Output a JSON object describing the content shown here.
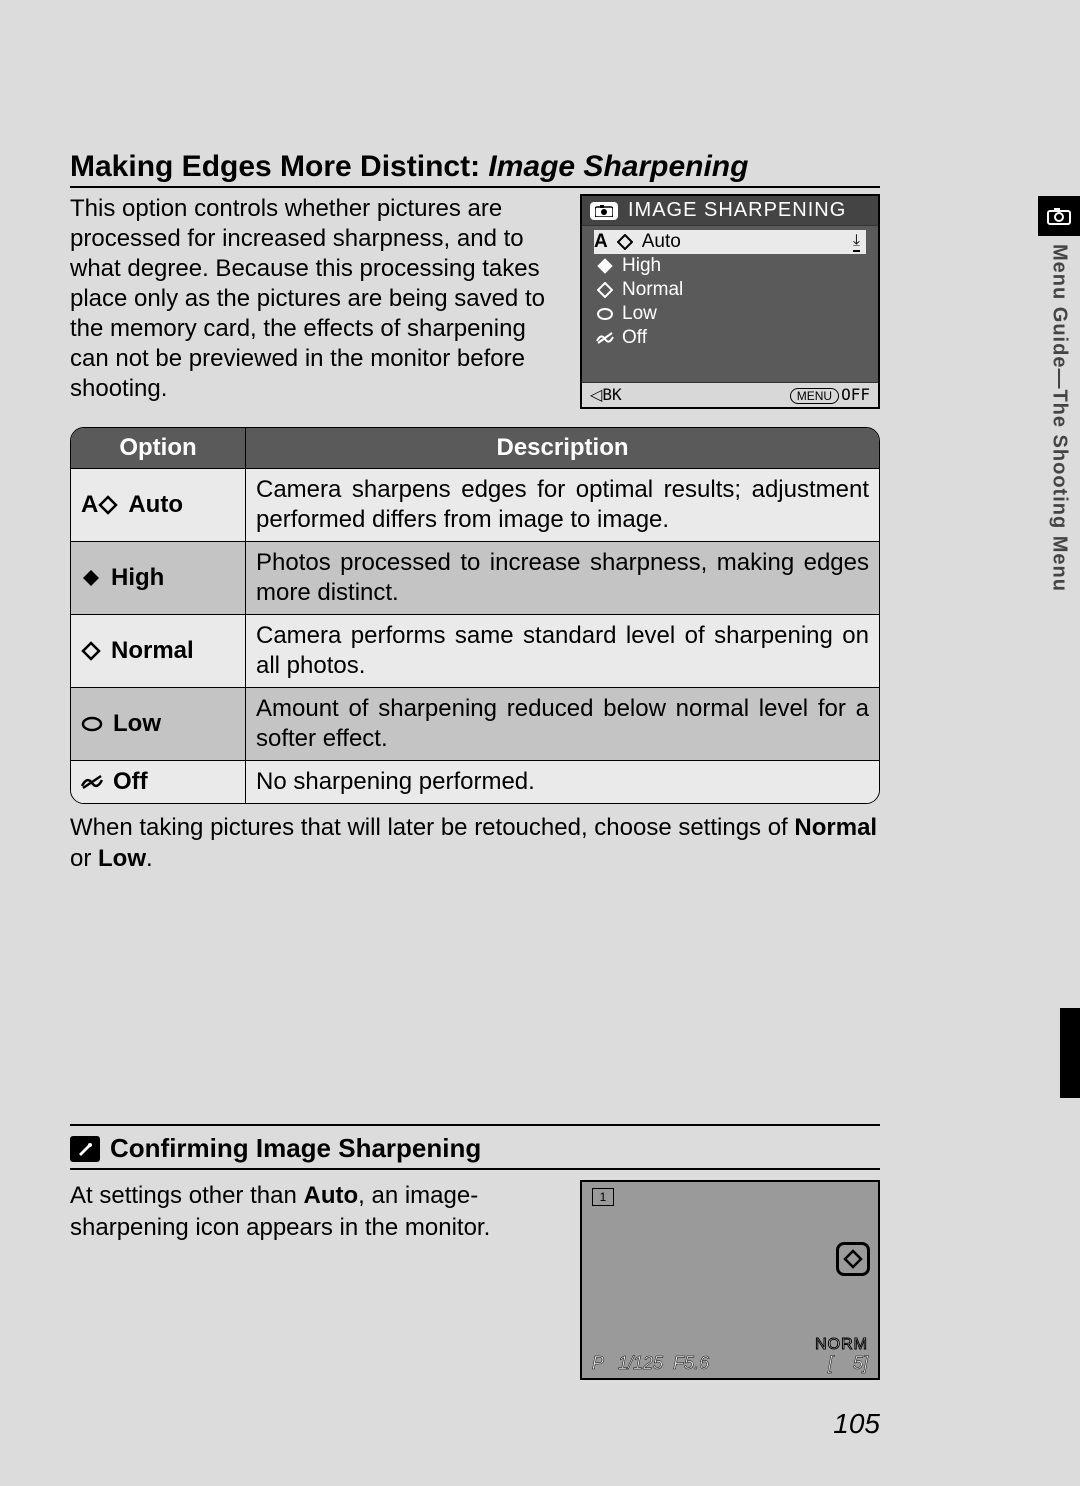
{
  "heading": {
    "prefix": "Making Edges More Distinct: ",
    "emph": "Image Sharpening"
  },
  "intro_text": "This option controls whether pictures are processed for increased sharpness, and to what degree. Because this processing takes place only as the pictures are being saved to the memory card, the effects of sharpening can not be previewed in the monitor before shooting.",
  "camera_screen": {
    "title": "IMAGE SHARPENING",
    "items": [
      "Auto",
      "High",
      "Normal",
      "Low",
      "Off"
    ],
    "selected_prefix": "A",
    "footer_back": "BK",
    "footer_menu": "MENU",
    "footer_off": "OFF"
  },
  "table": {
    "head_option": "Option",
    "head_desc": "Description",
    "rows": [
      {
        "prefix": "A",
        "name": "Auto",
        "desc": "Camera sharpens edges for optimal results; adjustment performed differs from image to image."
      },
      {
        "prefix": "",
        "name": "High",
        "desc": "Photos processed to increase sharpness, making edges more distinct."
      },
      {
        "prefix": "",
        "name": "Normal",
        "desc": "Camera performs same standard level of sharpening on all photos."
      },
      {
        "prefix": "",
        "name": "Low",
        "desc": "Amount of sharpening reduced below normal level for a softer effect."
      },
      {
        "prefix": "",
        "name": "Off",
        "desc": "No sharpening performed."
      }
    ]
  },
  "note": {
    "pre": "When taking pictures that will later be retouched, choose settings of ",
    "b1": "Normal",
    "mid": " or ",
    "b2": "Low",
    "post": "."
  },
  "subsection": {
    "heading": "Confirming Image Sharpening",
    "text_pre": "At settings other than ",
    "text_bold": "Auto",
    "text_post": ", an image-sharpening icon appears in the monitor."
  },
  "monitor": {
    "top_icon": "1",
    "norm": "NORM",
    "mode": "P",
    "shutter": "1/125",
    "aperture": "F5.6",
    "frames_open": "[",
    "frames": "5]"
  },
  "side_tab": "Menu Guide—The Shooting Menu",
  "page_number": "105"
}
